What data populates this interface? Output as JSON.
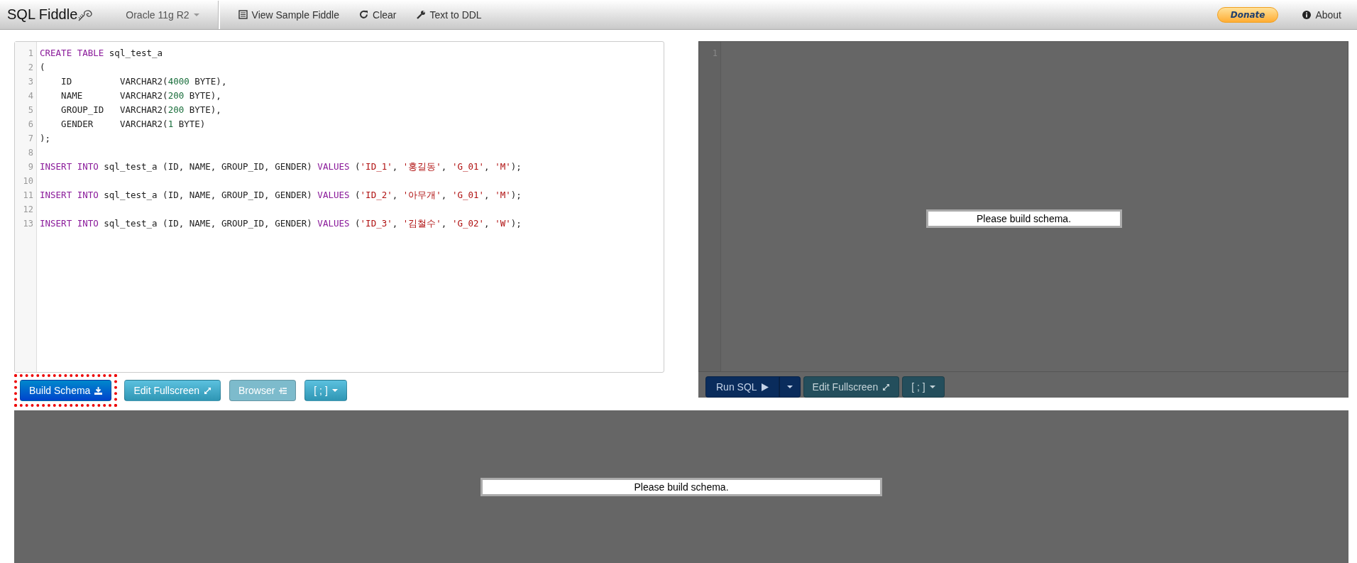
{
  "topbar": {
    "logo": "SQL Fiddle",
    "database": "Oracle 11g R2",
    "menu": [
      {
        "kind": "sample",
        "label": "View Sample Fiddle"
      },
      {
        "kind": "clear",
        "label": "Clear"
      },
      {
        "kind": "ddl",
        "label": "Text to DDL"
      }
    ],
    "donate": "Donate",
    "about": "About"
  },
  "schema_editor": {
    "lines": [
      {
        "n": "1",
        "tokens": [
          {
            "kind": "kw",
            "text": "CREATE TABLE"
          },
          {
            "kind": "txt",
            "text": " sql_test_a"
          }
        ]
      },
      {
        "n": "2",
        "tokens": [
          {
            "kind": "txt",
            "text": "("
          }
        ]
      },
      {
        "n": "3",
        "tokens": [
          {
            "kind": "txt",
            "text": "    ID         VARCHAR2("
          },
          {
            "kind": "num",
            "text": "4000"
          },
          {
            "kind": "txt",
            "text": " BYTE),"
          }
        ]
      },
      {
        "n": "4",
        "tokens": [
          {
            "kind": "txt",
            "text": "    NAME       VARCHAR2("
          },
          {
            "kind": "num",
            "text": "200"
          },
          {
            "kind": "txt",
            "text": " BYTE),"
          }
        ]
      },
      {
        "n": "5",
        "tokens": [
          {
            "kind": "txt",
            "text": "    GROUP_ID   VARCHAR2("
          },
          {
            "kind": "num",
            "text": "200"
          },
          {
            "kind": "txt",
            "text": " BYTE),"
          }
        ]
      },
      {
        "n": "6",
        "tokens": [
          {
            "kind": "txt",
            "text": "    GENDER     VARCHAR2("
          },
          {
            "kind": "num",
            "text": "1"
          },
          {
            "kind": "txt",
            "text": " BYTE)"
          }
        ]
      },
      {
        "n": "7",
        "tokens": [
          {
            "kind": "txt",
            "text": ");"
          }
        ]
      },
      {
        "n": "8"
      },
      {
        "n": "9",
        "tokens": [
          {
            "kind": "kw",
            "text": "INSERT INTO"
          },
          {
            "kind": "txt",
            "text": " sql_test_a (ID, NAME, GROUP_ID, GENDER) "
          },
          {
            "kind": "kw",
            "text": "VALUES"
          },
          {
            "kind": "txt",
            "text": " ("
          },
          {
            "kind": "str",
            "text": "'ID_1'"
          },
          {
            "kind": "txt",
            "text": ", "
          },
          {
            "kind": "str",
            "text": "'홍길동'"
          },
          {
            "kind": "txt",
            "text": ", "
          },
          {
            "kind": "str",
            "text": "'G_01'"
          },
          {
            "kind": "txt",
            "text": ", "
          },
          {
            "kind": "str",
            "text": "'M'"
          },
          {
            "kind": "txt",
            "text": ");"
          }
        ]
      },
      {
        "n": "10"
      },
      {
        "n": "11",
        "tokens": [
          {
            "kind": "kw",
            "text": "INSERT INTO"
          },
          {
            "kind": "txt",
            "text": " sql_test_a (ID, NAME, GROUP_ID, GENDER) "
          },
          {
            "kind": "kw",
            "text": "VALUES"
          },
          {
            "kind": "txt",
            "text": " ("
          },
          {
            "kind": "str",
            "text": "'ID_2'"
          },
          {
            "kind": "txt",
            "text": ", "
          },
          {
            "kind": "str",
            "text": "'아무개'"
          },
          {
            "kind": "txt",
            "text": ", "
          },
          {
            "kind": "str",
            "text": "'G_01'"
          },
          {
            "kind": "txt",
            "text": ", "
          },
          {
            "kind": "str",
            "text": "'M'"
          },
          {
            "kind": "txt",
            "text": ");"
          }
        ]
      },
      {
        "n": "12"
      },
      {
        "n": "13",
        "tokens": [
          {
            "kind": "kw",
            "text": "INSERT INTO"
          },
          {
            "kind": "txt",
            "text": " sql_test_a (ID, NAME, GROUP_ID, GENDER) "
          },
          {
            "kind": "kw",
            "text": "VALUES"
          },
          {
            "kind": "txt",
            "text": " ("
          },
          {
            "kind": "str",
            "text": "'ID_3'"
          },
          {
            "kind": "txt",
            "text": ", "
          },
          {
            "kind": "str",
            "text": "'김철수'"
          },
          {
            "kind": "txt",
            "text": ", "
          },
          {
            "kind": "str",
            "text": "'G_02'"
          },
          {
            "kind": "txt",
            "text": ", "
          },
          {
            "kind": "str",
            "text": "'W'"
          },
          {
            "kind": "txt",
            "text": ");"
          }
        ]
      }
    ],
    "buttons": [
      {
        "kind": "build",
        "label": "Build Schema",
        "highlighted": true
      },
      {
        "kind": "fullscreen",
        "label": "Edit Fullscreen",
        "highlighted": false
      },
      {
        "kind": "browser",
        "label": "Browser",
        "highlighted": false
      },
      {
        "kind": "terminator",
        "label": "[ ; ]",
        "highlighted": false
      }
    ]
  },
  "query_editor": {
    "line_number": "1",
    "message": "Please build schema.",
    "disabled": true,
    "buttons": [
      {
        "kind": "run",
        "label": "Run SQL"
      },
      {
        "kind": "fullscreen",
        "label": "Edit Fullscreen"
      },
      {
        "kind": "terminator",
        "label": "[ ; ]"
      }
    ]
  },
  "results": {
    "message": "Please build schema."
  }
}
